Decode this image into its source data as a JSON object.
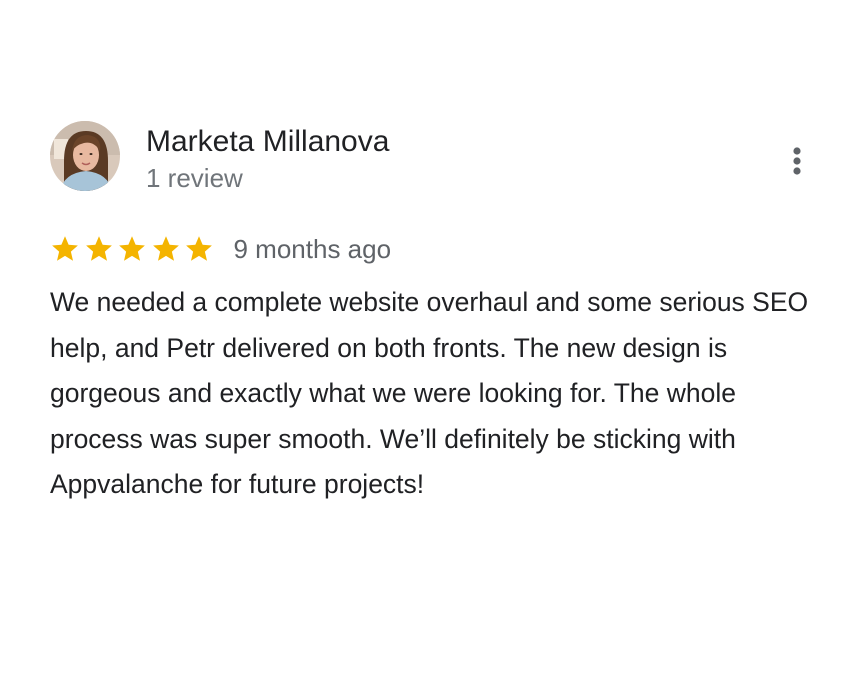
{
  "review": {
    "reviewer_name": "Marketa Millanova",
    "review_count": "1 review",
    "rating": 5,
    "rating_max": 5,
    "star_color": "#F4B400",
    "date": "9 months ago",
    "text": "We needed a complete website overhaul and some serious SEO help, and Petr delivered on both fronts. The new design is gorgeous and exactly what we were looking for. The whole process was super smooth. We’ll definitely be sticking with Appvalanche for future projects!",
    "avatar_icon": "profile-photo",
    "more_icon": "more-vert-icon"
  }
}
